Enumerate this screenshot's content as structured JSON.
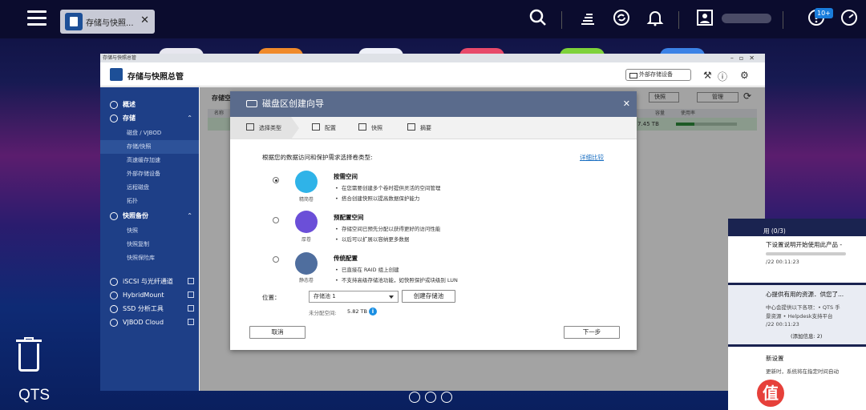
{
  "taskbar": {
    "tab_label": "存储与快照...",
    "close": "✕",
    "badge": "10+"
  },
  "window": {
    "titlebar": "存储与快照总管",
    "title": "存储与快照总管",
    "external_device": "外部存储设备",
    "controls": "–▫✕"
  },
  "sidebar": {
    "overview": "概述",
    "storage": "存储",
    "storage_items": [
      "磁盘 / VJBOD",
      "存储/快照",
      "高速缓存加速",
      "外部存储设备",
      "远程磁盘",
      "拓扑"
    ],
    "snapshot_backup": "快照备份",
    "snapshot_items": [
      "快照",
      "快照复制",
      "快照保险库"
    ],
    "ext_items": [
      "iSCSI 与光纤通道",
      "HybridMount",
      "SSD 分析工具",
      "VJBOD Cloud"
    ]
  },
  "main": {
    "title": "存储空",
    "btn_snapshot": "快照",
    "btn_manage": "管理",
    "col_name": "名称",
    "col_capacity": "容量",
    "col_usage": "使用率",
    "row_capacity": "7.45 TB"
  },
  "dialog": {
    "title": "磁盘区创建向导",
    "steps": [
      "选择类型",
      "配置",
      "快照",
      "摘要"
    ],
    "prompt": "根据您的数据访问和保护需求选择卷类型:",
    "detail_link": "详细比较",
    "options": [
      {
        "icon_caption": "精简卷",
        "title": "按需空间",
        "lines": [
          "在您需要创建多个卷时提供灵活的空间管理",
          "搭合创建快照以提高数据保护能力"
        ],
        "selected": true,
        "color": "#2fb3e8"
      },
      {
        "icon_caption": "厚卷",
        "title": "预配置空间",
        "lines": [
          "存储空间已预先分配以获得更好的访问性能",
          "以后可以扩展以容纳更多数据"
        ],
        "selected": false,
        "color": "#6b4fd8"
      },
      {
        "icon_caption": "静态卷",
        "title": "传统配置",
        "lines": [
          "已直接在 RAID 组上创建",
          "不支持高级存储池功能，如快照保护或块级别 LUN"
        ],
        "selected": false,
        "color": "#4f6e9e"
      }
    ],
    "location_label": "位置：",
    "location_value": "存储池 1",
    "create_pool": "创建存储池",
    "free_label": "未分配空间:",
    "free_value": "5.82 TB",
    "cancel": "取消",
    "next": "下一步"
  },
  "notifications": {
    "header": "用 (0/3)",
    "items": [
      {
        "text": "下设置说明开始使用此产品 -",
        "time": "/22 00:11:23"
      },
      {
        "text": "心提供有用的资源．供您了...",
        "line2": "中心会提供以下各项：• QTS 手",
        "line3": "景资源 • Helpdesk支持平台",
        "time": "/22 00:11:23",
        "more": "(添加信息: 2)"
      },
      {
        "text": "新设置",
        "line2": "更新时，系统将在指定时间自动"
      }
    ]
  },
  "desktop": {
    "qts": "QTS",
    "watermark": "什么值得买"
  }
}
